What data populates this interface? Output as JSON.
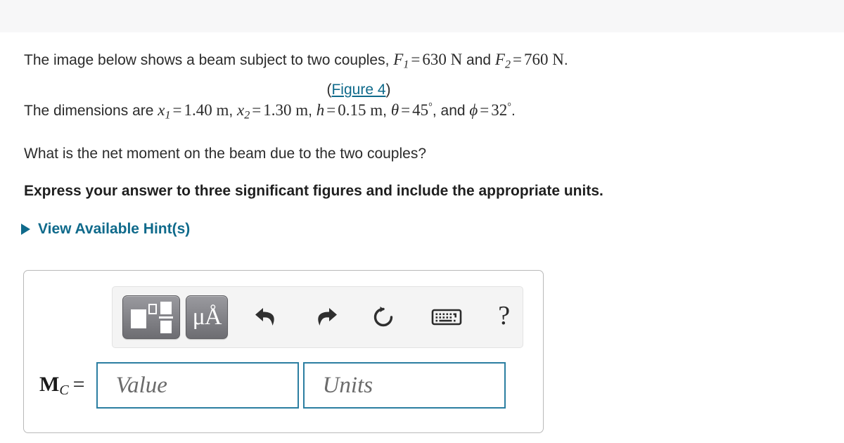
{
  "problem": {
    "line1": {
      "text_before": "The image below shows a beam subject to two couples, ",
      "f1_symbol": "F",
      "f1_sub": "1",
      "eq1": "=",
      "f1_value": "630 N",
      "conj": " and ",
      "f2_symbol": "F",
      "f2_sub": "2",
      "eq2": "=",
      "f2_value": "760 N",
      "period": "."
    },
    "figure": {
      "open_paren": "(",
      "link_label": "Figure 4",
      "close_paren": ")",
      "link_color": "#0f6a8b"
    },
    "line2": {
      "text_before": "The dimensions are ",
      "x1_symbol": "x",
      "x1_sub": "1",
      "x1_eq": "=",
      "x1_value": "1.40 m",
      "sep1": ", ",
      "x2_symbol": "x",
      "x2_sub": "2",
      "x2_eq": "=",
      "x2_value": "1.30 m",
      "sep2": ", ",
      "h_symbol": "h",
      "h_eq": "=",
      "h_value": "0.15 m",
      "sep3": ", ",
      "theta_symbol": "θ",
      "theta_eq": "=",
      "theta_value": "45",
      "theta_deg": "°",
      "sep4": ", and ",
      "phi_symbol": "ϕ",
      "phi_eq": "=",
      "phi_value": "32",
      "phi_deg": "°",
      "period": "."
    },
    "question": "What is the net moment on the beam due to the two couples?",
    "instruction": "Express your answer to three significant figures and include the appropriate units."
  },
  "hints": {
    "label": "View Available Hint(s)",
    "disclosure_icon": "triangle-right-icon",
    "expanded": false
  },
  "answer_panel": {
    "toolbar": {
      "buttons": [
        {
          "name": "math-template-button",
          "icon": "math-template-icon",
          "label": ""
        },
        {
          "name": "units-button",
          "icon": "micro-angstrom-icon",
          "label": "μÅ"
        },
        {
          "name": "undo-button",
          "icon": "undo-arrow-icon",
          "label": ""
        },
        {
          "name": "redo-button",
          "icon": "redo-arrow-icon",
          "label": ""
        },
        {
          "name": "reset-button",
          "icon": "reset-circular-arrow-icon",
          "label": ""
        },
        {
          "name": "keyboard-button",
          "icon": "keyboard-icon",
          "label": ""
        },
        {
          "name": "help-button",
          "icon": "question-mark-icon",
          "label": "?"
        }
      ]
    },
    "answer": {
      "symbol": "M",
      "symbol_sub": "C",
      "equals": "=",
      "value_field": {
        "value": "",
        "placeholder": "Value"
      },
      "units_field": {
        "value": "",
        "placeholder": "Units"
      },
      "border_color": "#2b7ea1"
    }
  }
}
